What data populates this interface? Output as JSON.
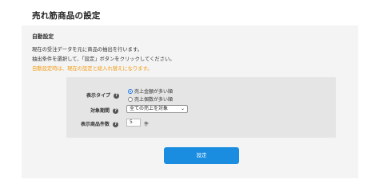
{
  "page": {
    "title": "売れ筋商品の設定",
    "section_title": "自動設定",
    "description_line1": "現在の受注データを元に商品の抽出を行います。",
    "description_line2": "抽出条件を選択して、「設定」ボタンをクリックしてください。",
    "warning": "自動設定時は、現在の設定と総入れ替えになります。"
  },
  "form": {
    "display_type_label": "表示タイプ",
    "display_type_options": [
      "売上金額が多い順",
      "売上個数が多い順"
    ],
    "display_type_selected": 0,
    "period_label": "対象期間",
    "period_value": "全ての売上を対象",
    "count_label": "表示商品件数",
    "count_value": "5",
    "count_unit": "件",
    "help_symbol": "?"
  },
  "actions": {
    "submit_label": "設定"
  },
  "colors": {
    "accent": "#1a8de0",
    "warning": "#f39c12",
    "panel_bg": "#f4f4f4",
    "box_bg": "#e5e5e5"
  }
}
